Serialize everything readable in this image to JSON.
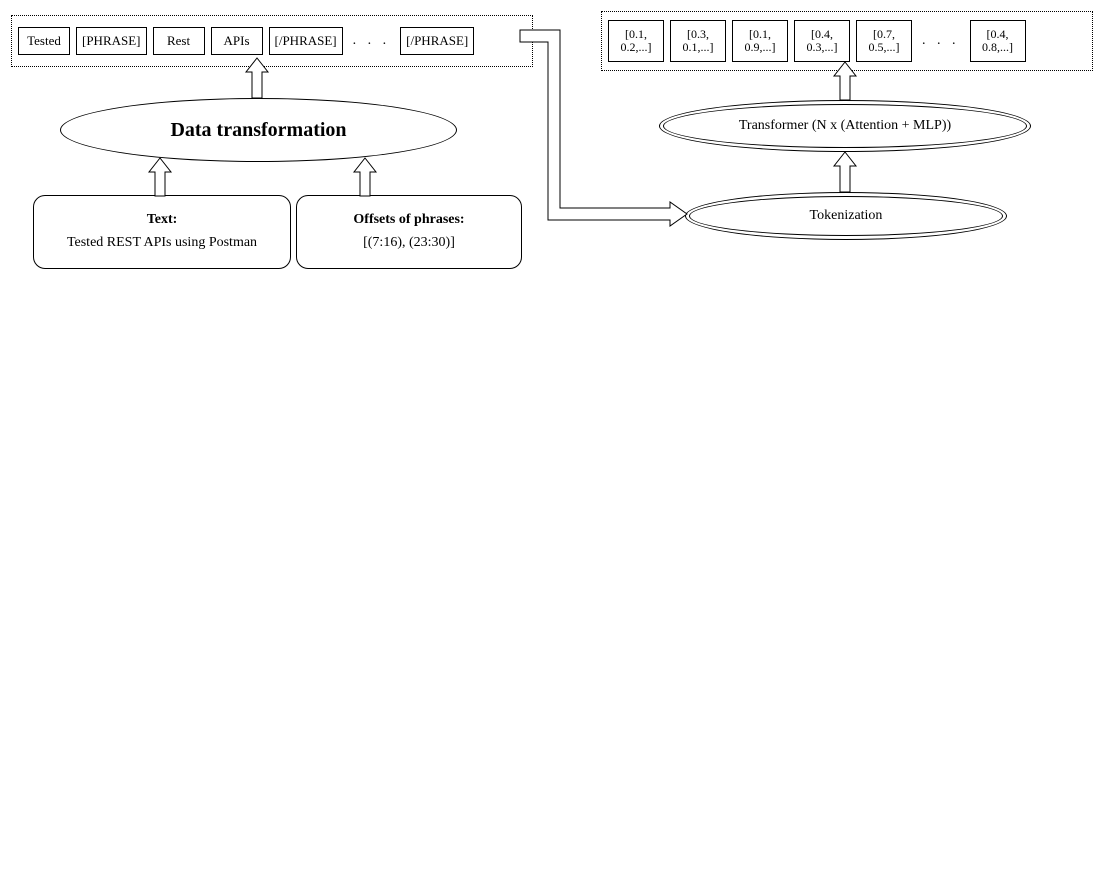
{
  "left_tokens": {
    "items": [
      "Tested",
      "[PHRASE]",
      "Rest",
      "APIs",
      "[/PHRASE]"
    ],
    "ellipsis": ". . .",
    "tail": "[/PHRASE]"
  },
  "right_vectors": {
    "items": [
      "[0.1, 0.2,...]",
      "[0.3, 0.1,...]",
      "[0.1, 0.9,...]",
      "[0.4, 0.3,...]",
      "[0.7, 0.5,...]"
    ],
    "ellipsis": ". . .",
    "tail": "[0.4, 0.8,...]"
  },
  "nodes": {
    "data_transformation": "Data transformation",
    "transformer": "Transformer (N x (Attention + MLP))",
    "tokenization": "Tokenization"
  },
  "inputs": {
    "text_title": "Text:",
    "text_value": "Tested REST APIs using Postman",
    "offsets_title": "Offsets of phrases:",
    "offsets_value": "[(7:16), (23:30)]"
  }
}
